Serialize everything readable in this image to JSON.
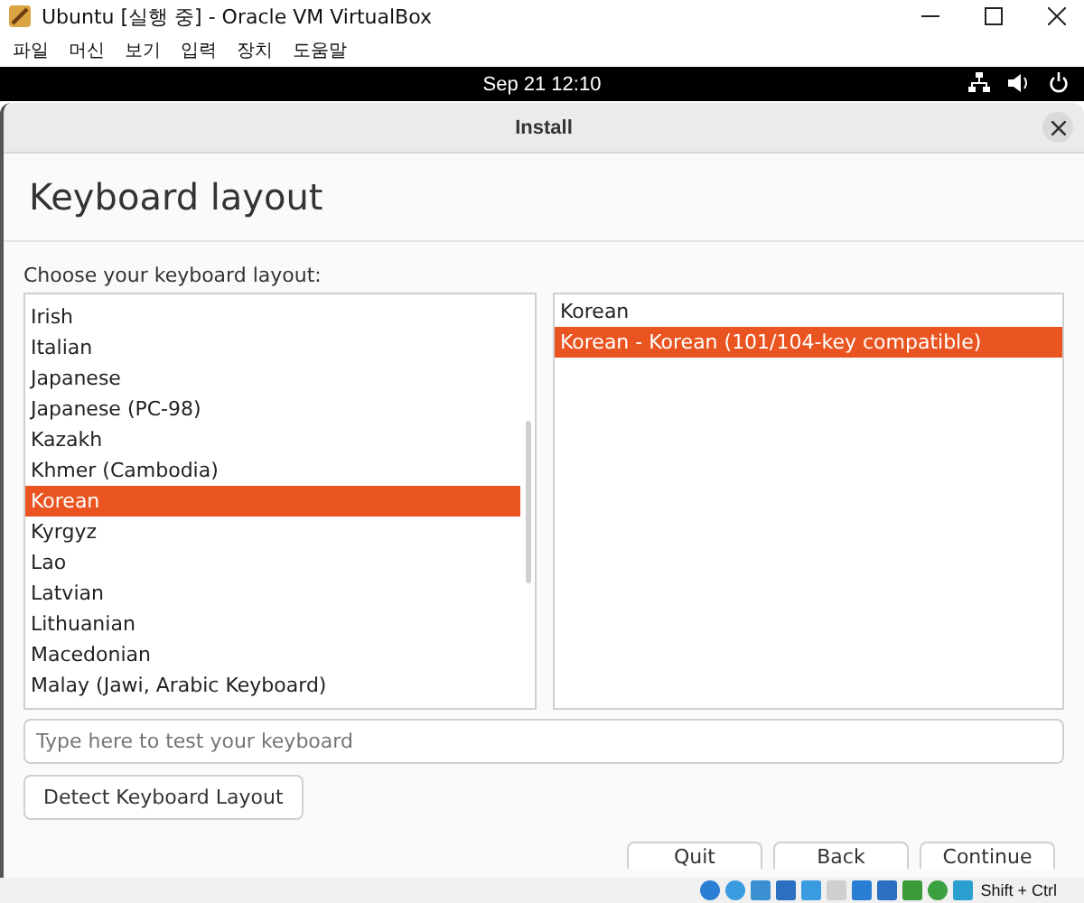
{
  "host_window": {
    "title": "Ubuntu [실행 중] - Oracle VM VirtualBox"
  },
  "host_menu": [
    "파일",
    "머신",
    "보기",
    "입력",
    "장치",
    "도움말"
  ],
  "top_bar": {
    "clock": "Sep 21  12:10"
  },
  "dialog": {
    "title": "Install",
    "heading": "Keyboard layout",
    "prompt": "Choose your keyboard layout:",
    "layouts": [
      {
        "label": "Irish",
        "selected": false
      },
      {
        "label": "Italian",
        "selected": false
      },
      {
        "label": "Japanese",
        "selected": false
      },
      {
        "label": "Japanese (PC-98)",
        "selected": false
      },
      {
        "label": "Kazakh",
        "selected": false
      },
      {
        "label": "Khmer (Cambodia)",
        "selected": false
      },
      {
        "label": "Korean",
        "selected": true
      },
      {
        "label": "Kyrgyz",
        "selected": false
      },
      {
        "label": "Lao",
        "selected": false
      },
      {
        "label": "Latvian",
        "selected": false
      },
      {
        "label": "Lithuanian",
        "selected": false
      },
      {
        "label": "Macedonian",
        "selected": false
      },
      {
        "label": "Malay (Jawi, Arabic Keyboard)",
        "selected": false
      }
    ],
    "variants": [
      {
        "label": "Korean",
        "selected": false
      },
      {
        "label": "Korean - Korean (101/104-key compatible)",
        "selected": true
      }
    ],
    "test_field": {
      "placeholder": "Type here to test your keyboard"
    },
    "detect_button": "Detect Keyboard Layout",
    "buttons": [
      "Quit",
      "Back",
      "Continue"
    ]
  },
  "host_status": {
    "key_hint": "Shift + Ctrl"
  }
}
